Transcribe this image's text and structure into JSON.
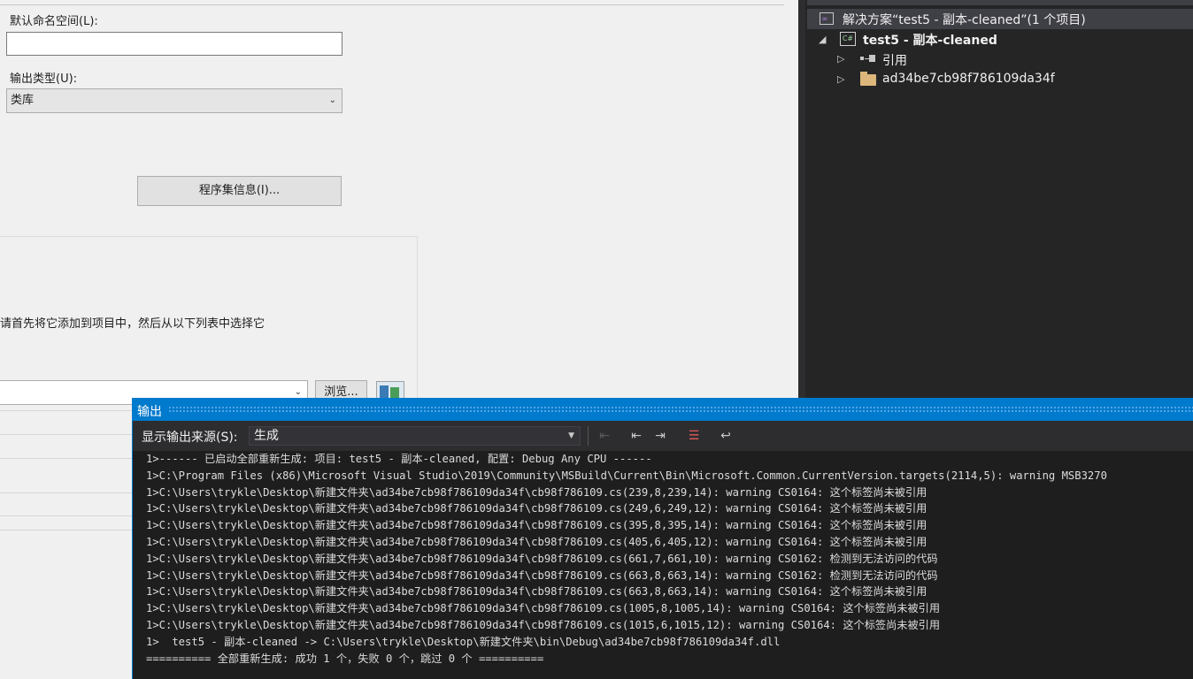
{
  "props": {
    "default_namespace_label": "默认命名空间(L):",
    "default_namespace_value": "",
    "output_type_label": "输出类型(U):",
    "output_type_value": "类库",
    "assembly_info_button": "程序集信息(I)...",
    "hint_text": "请首先将它添加到项目中，然后从以下列表中选择它",
    "browse_button": "浏览..."
  },
  "solution_explorer": {
    "solution_label": "解决方案“test5 - 副本-cleaned”(1 个项目)",
    "project_label": "test5 - 副本-cleaned",
    "items": [
      {
        "label": "引用",
        "icon": "references-icon"
      },
      {
        "label": "ad34be7cb98f786109da34f",
        "icon": "folder-icon"
      }
    ]
  },
  "output": {
    "title": "输出",
    "source_label": "显示输出来源(S):",
    "source_value": "生成",
    "lines": [
      "1>------ 已启动全部重新生成: 项目: test5 - 副本-cleaned, 配置: Debug Any CPU ------",
      "1>C:\\Program Files (x86)\\Microsoft Visual Studio\\2019\\Community\\MSBuild\\Current\\Bin\\Microsoft.Common.CurrentVersion.targets(2114,5): warning MSB3270",
      "1>C:\\Users\\trykle\\Desktop\\新建文件夹\\ad34be7cb98f786109da34f\\cb98f786109.cs(239,8,239,14): warning CS0164: 这个标签尚未被引用",
      "1>C:\\Users\\trykle\\Desktop\\新建文件夹\\ad34be7cb98f786109da34f\\cb98f786109.cs(249,6,249,12): warning CS0164: 这个标签尚未被引用",
      "1>C:\\Users\\trykle\\Desktop\\新建文件夹\\ad34be7cb98f786109da34f\\cb98f786109.cs(395,8,395,14): warning CS0164: 这个标签尚未被引用",
      "1>C:\\Users\\trykle\\Desktop\\新建文件夹\\ad34be7cb98f786109da34f\\cb98f786109.cs(405,6,405,12): warning CS0164: 这个标签尚未被引用",
      "1>C:\\Users\\trykle\\Desktop\\新建文件夹\\ad34be7cb98f786109da34f\\cb98f786109.cs(661,7,661,10): warning CS0162: 检测到无法访问的代码",
      "1>C:\\Users\\trykle\\Desktop\\新建文件夹\\ad34be7cb98f786109da34f\\cb98f786109.cs(663,8,663,14): warning CS0162: 检测到无法访问的代码",
      "1>C:\\Users\\trykle\\Desktop\\新建文件夹\\ad34be7cb98f786109da34f\\cb98f786109.cs(663,8,663,14): warning CS0164: 这个标签尚未被引用",
      "1>C:\\Users\\trykle\\Desktop\\新建文件夹\\ad34be7cb98f786109da34f\\cb98f786109.cs(1005,8,1005,14): warning CS0164: 这个标签尚未被引用",
      "1>C:\\Users\\trykle\\Desktop\\新建文件夹\\ad34be7cb98f786109da34f\\cb98f786109.cs(1015,6,1015,12): warning CS0164: 这个标签尚未被引用",
      "1>  test5 - 副本-cleaned -> C:\\Users\\trykle\\Desktop\\新建文件夹\\bin\\Debug\\ad34be7cb98f786109da34f.dll",
      "========== 全部重新生成: 成功 1 个，失败 0 个，跳过 0 个 =========="
    ]
  }
}
